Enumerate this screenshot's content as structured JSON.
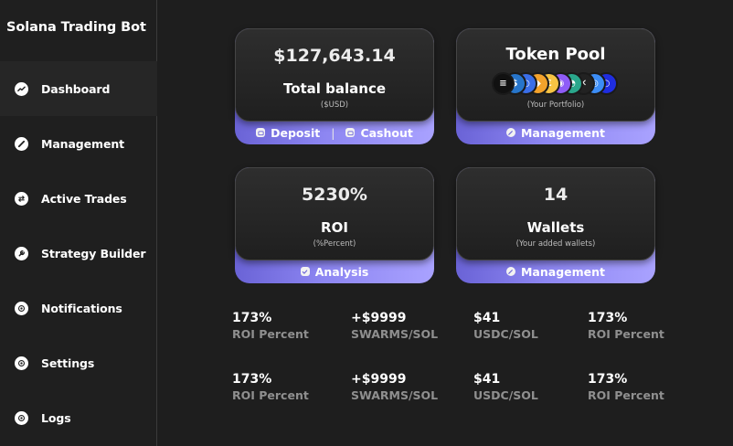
{
  "app": {
    "title": "Solana Trading Bot"
  },
  "sidebar": {
    "items": [
      {
        "label": "Dashboard",
        "icon": "chart-icon",
        "active": true
      },
      {
        "label": "Management",
        "icon": "pen-icon"
      },
      {
        "label": "Active Trades",
        "icon": "swap-icon"
      },
      {
        "label": "Strategy Builder",
        "icon": "wrench-icon"
      },
      {
        "label": "Notifications",
        "icon": "target-icon"
      },
      {
        "label": "Settings",
        "icon": "target-icon"
      },
      {
        "label": "Logs",
        "icon": "target-icon"
      }
    ]
  },
  "cards": {
    "balance": {
      "value": "$127,643.14",
      "title": "Total balance",
      "subtitle": "($USD)",
      "deposit_label": "Deposit",
      "separator": "|",
      "cashout_label": "Cashout"
    },
    "token_pool": {
      "title": "Token Pool",
      "subtitle": "(Your Portfolio)",
      "action_label": "Management",
      "tokens": [
        {
          "icon": "solana-token-icon",
          "color": "#111111",
          "glyph": "≡"
        },
        {
          "icon": "usdc-token-icon",
          "color": "#2775ca",
          "glyph": "$"
        },
        {
          "icon": "generic-token-icon",
          "color": "#3a6ee8",
          "glyph": "◐"
        },
        {
          "icon": "bonk-token-icon",
          "color": "#f3a22b",
          "glyph": "◆"
        },
        {
          "icon": "yellow-token-icon",
          "color": "#f6c343",
          "glyph": "Ɛ"
        },
        {
          "icon": "purple-token-icon",
          "color": "#8e5cf7",
          "glyph": "◉"
        },
        {
          "icon": "teal-token-icon",
          "color": "#2aa78c",
          "glyph": "◓"
        },
        {
          "icon": "dark-token-icon",
          "color": "#222222",
          "glyph": "✕"
        },
        {
          "icon": "blue-token-icon",
          "color": "#3c8df6",
          "glyph": "◎"
        },
        {
          "icon": "ring-token-icon",
          "color": "#1f2de0",
          "glyph": "○"
        }
      ]
    },
    "roi": {
      "value": "5230%",
      "title": "ROI",
      "subtitle": "(%Percent)",
      "action_label": "Analysis"
    },
    "wallets": {
      "value": "14",
      "title": "Wallets",
      "subtitle": "(Your added wallets)",
      "action_label": "Management"
    }
  },
  "stats": {
    "rows": [
      [
        {
          "value": "173%",
          "label": "ROI Percent"
        },
        {
          "value": "+$9999",
          "label": "SWARMS/SOL"
        },
        {
          "value": "$41",
          "label": "USDC/SOL"
        },
        {
          "value": "173%",
          "label": "ROI Percent"
        }
      ],
      [
        {
          "value": "173%",
          "label": "ROI Percent"
        },
        {
          "value": "+$9999",
          "label": "SWARMS/SOL"
        },
        {
          "value": "$41",
          "label": "USDC/SOL"
        },
        {
          "value": "173%",
          "label": "ROI Percent"
        }
      ]
    ]
  },
  "colors": {
    "background": "#1e1e1e",
    "accent": "#8d86f2",
    "muted_text": "#8f8f8f"
  }
}
